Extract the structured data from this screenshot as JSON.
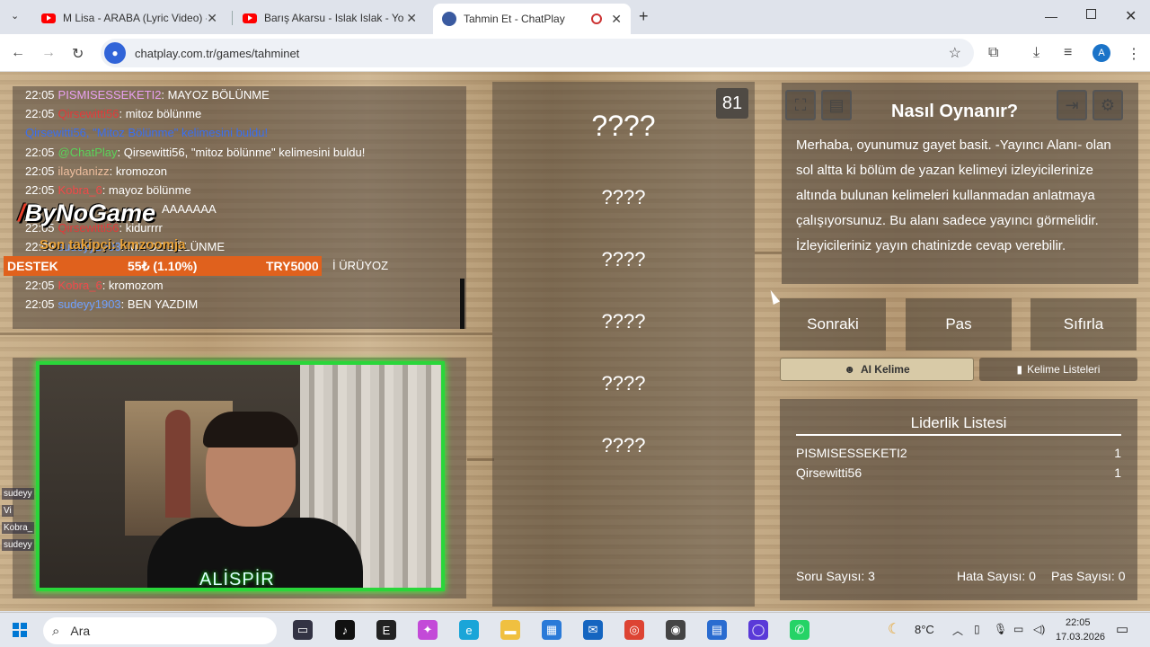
{
  "browser": {
    "tabs": [
      {
        "title": "M Lisa - ARABA (Lyric Video) - Y"
      },
      {
        "title": "Barış Akarsu - Islak Islak - YouT"
      },
      {
        "title": "Tahmin Et - ChatPlay"
      }
    ],
    "new_tab": "+",
    "url": "chatplay.com.tr/games/tahminet",
    "profile_initial": "A"
  },
  "chat": {
    "lines": [
      {
        "time": "22:05",
        "user": "PISMISESSEKETI2",
        "user_color": "#e8a0f0",
        "msg": ": MAYOZ BÖLÜNME"
      },
      {
        "time": "22:05",
        "user": "Qirsewitti56",
        "user_color": "#e23a3a",
        "msg": ": mitoz bölünme"
      },
      {
        "time": "",
        "user": "Qirsewitti56, \"Mitoz Bölünme\" kelimesini buldu!",
        "user_color": "#3a6ff0",
        "msg": ""
      },
      {
        "time": "22:05",
        "user": "@ChatPlay",
        "user_color": "#5ad45a",
        "msg": ": Qirsewitti56, \"mitoz bölünme\" kelimesini buldu!"
      },
      {
        "time": "22:05",
        "user": "ilaydanizz",
        "user_color": "#f0c0a0",
        "msg": ": kromozon"
      },
      {
        "time": "22:05",
        "user": "Kobra_6",
        "user_color": "#f04a4a",
        "msg": ": mayoz bölünme"
      },
      {
        "time": "",
        "user": "",
        "user_color": "#fff",
        "msg": "AAAAAAA"
      },
      {
        "time": "22:05",
        "user": "Qirsewitti56",
        "user_color": "#e23a3a",
        "msg": ": kidurrrr"
      },
      {
        "time": "22:05",
        "user": "sudeyy1903",
        "user_color": "#6fa0ff",
        "msg": ": MITOZ BÖLÜNME"
      },
      {
        "time": "",
        "user": "",
        "user_color": "#fff",
        "msg": "İ ÜRÜYOZ"
      },
      {
        "time": "22:05",
        "user": "Kobra_6",
        "user_color": "#f04a4a",
        "msg": ": kromozom"
      },
      {
        "time": "22:05",
        "user": "sudeyy1903",
        "user_color": "#6fa0ff",
        "msg": ": BEN YAZDIM"
      }
    ],
    "logo": "ByNoGame",
    "last_supporter": "Son takipçi: ",
    "last_supporter_name": "kmzoomja",
    "destek": {
      "label": "DESTEK",
      "amount": "55₺ (1.10%)",
      "goal": "TRY5000"
    }
  },
  "camera": {
    "name": "ALİSPİR"
  },
  "side_chat": [
    "sudeyy",
    "Vi",
    "Kobra_",
    "sudeyy"
  ],
  "game": {
    "question_count": "81",
    "words": [
      "????",
      "????",
      "????",
      "????",
      "????",
      "????"
    ]
  },
  "help": {
    "title": "Nasıl Oynanır?",
    "text": "Merhaba, oyunumuz gayet basit. -Yayıncı Alanı- olan sol altta ki bölüm de yazan kelimeyi izleyicilerinize altında bulunan kelimeleri kullanmadan anlatmaya çalışıyorsunuz. Bu alanı sadece yayıncı görmelidir. İzleyicileriniz yayın chatinizde cevap verebilir."
  },
  "buttons": {
    "next": "Sonraki",
    "pass": "Pas",
    "reset": "Sıfırla",
    "ai": "AI Kelime",
    "lists": "Kelime Listeleri"
  },
  "leaderboard": {
    "title": "Liderlik Listesi",
    "rows": [
      {
        "name": "PISMISESSEKETI2",
        "score": "1"
      },
      {
        "name": "Qirsewitti56",
        "score": "1"
      }
    ]
  },
  "stats": {
    "questions": "Soru Sayısı: 3",
    "errors": "Hata Sayısı: 0",
    "passes": "Pas Sayısı: 0"
  },
  "taskbar": {
    "search": "Ara",
    "temp": "8°C",
    "time": "22:05",
    "date": "17.03.2026"
  }
}
